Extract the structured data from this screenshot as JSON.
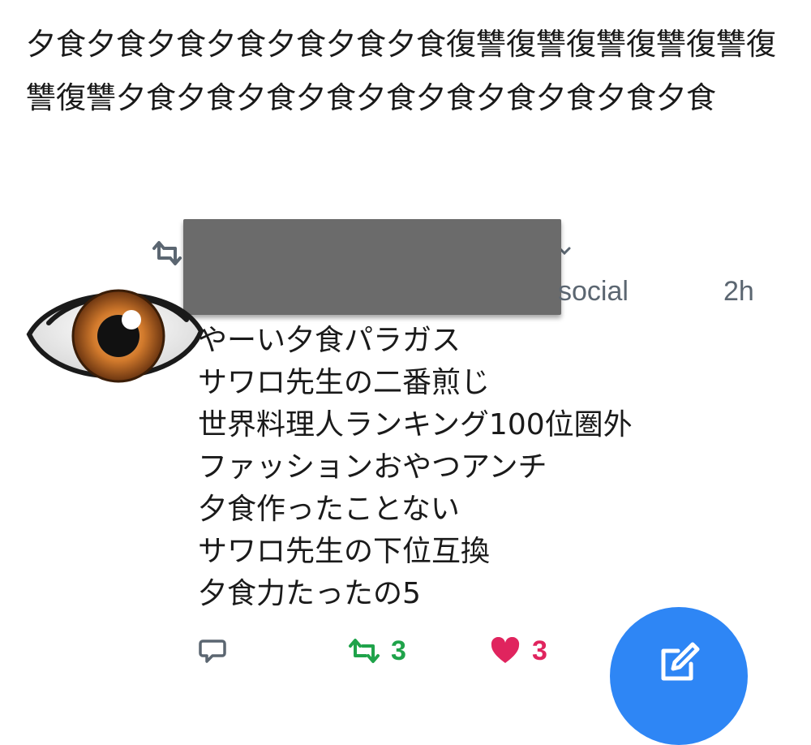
{
  "header_text": "夕食夕食夕食夕食夕食夕食夕食復讐復讐復讐復讐復讐復讐復讐夕食夕食夕食夕食夕食夕食夕食夕食夕食夕食",
  "tweet": {
    "handle": "social",
    "timestamp": "2h",
    "lines": [
      "やーい夕食パラガス",
      "サワロ先生の二番煎じ",
      "世界料理人ランキング100位圏外",
      "ファッションおやつアンチ",
      "夕食作ったことない",
      "サワロ先生の下位互換",
      "夕食力たったの5"
    ],
    "retweet_count": "3",
    "like_count": "3"
  },
  "icons": {
    "retweeted_by": "retweet-icon",
    "avatar": "eye-icon",
    "reply": "reply-icon",
    "retweet": "retweet-icon",
    "like": "heart-icon",
    "compose": "compose-icon"
  },
  "colors": {
    "retweet": "#1fa34a",
    "like": "#e0245e",
    "fab": "#2e86f5",
    "muted": "#5b6671"
  }
}
